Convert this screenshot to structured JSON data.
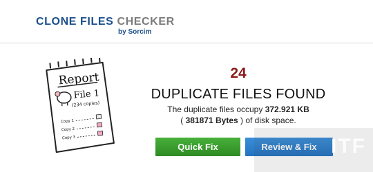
{
  "brand": {
    "name_part1": "CLONE FILES ",
    "name_part2": "CHECKER",
    "by_line": "by Sorcim"
  },
  "report_illustration": {
    "title": "Report",
    "file_label": "File 1",
    "copies_label": "(234 copies)",
    "rows": [
      "Copy 1",
      "Copy 2",
      "Copy 3"
    ]
  },
  "result": {
    "count": "24",
    "headline": "DUPLICATE FILES FOUND",
    "occupy_prefix": "The duplicate files occupy ",
    "occupy_size": "372.921 KB",
    "bytes_prefix": "( ",
    "bytes_value": "381871 Bytes",
    "bytes_suffix": " ) of disk space."
  },
  "actions": {
    "quick_fix": "Quick Fix",
    "review_fix": "Review & Fix"
  },
  "colors": {
    "brand_blue": "#1b4f8c",
    "count_red": "#8b1a1a",
    "quick_fix_green": "#3a9e2e",
    "review_fix_blue": "#2f81cf"
  }
}
